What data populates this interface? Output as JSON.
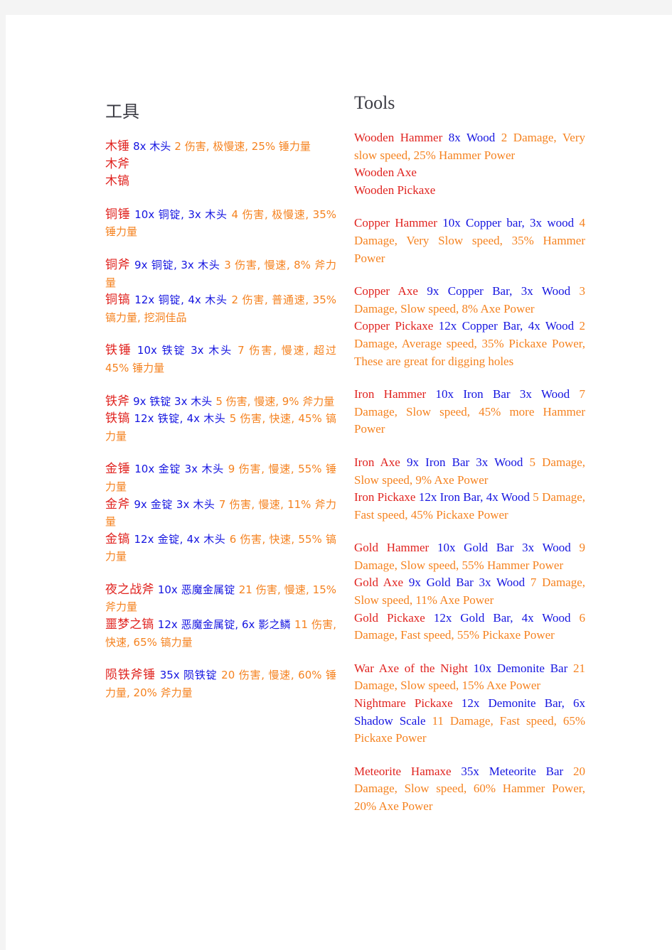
{
  "page": {
    "background": "#f4f4f4",
    "paper": "#ffffff",
    "colors": {
      "name": "#e0231f",
      "material": "#1414e0",
      "stat": "#f5821f",
      "heading": "#3a3a42"
    }
  },
  "columns": [
    {
      "id": "chinese",
      "lang": "zh",
      "heading": "工具",
      "groups": [
        {
          "entries": [
            {
              "name": "木锤",
              "material": "8x 木头",
              "stat": "2 伤害, 极慢速, 25% 锤力量"
            },
            {
              "name": "木斧",
              "material": "",
              "stat": ""
            },
            {
              "name": "木镐",
              "material": "",
              "stat": ""
            }
          ]
        },
        {
          "entries": [
            {
              "name": "铜锤",
              "material": "10x 铜锭, 3x 木头",
              "stat": "4 伤害, 极慢速, 35% 锤力量"
            }
          ]
        },
        {
          "entries": [
            {
              "name": "铜斧",
              "material": "9x 铜锭, 3x 木头",
              "stat": "3 伤害, 慢速, 8% 斧力量"
            },
            {
              "name": "铜镐",
              "material": "12x 铜锭, 4x 木头",
              "stat": "2 伤害, 普通速, 35% 镐力量, 挖洞佳品"
            }
          ]
        },
        {
          "entries": [
            {
              "name": "铁锤",
              "material": "10x 铁锭 3x 木头",
              "stat": "7 伤害, 慢速, 超过 45% 锤力量"
            }
          ]
        },
        {
          "entries": [
            {
              "name": "铁斧",
              "material": "9x 铁锭 3x 木头",
              "stat": "5 伤害, 慢速, 9% 斧力量"
            },
            {
              "name": "铁镐",
              "material": "12x 铁锭, 4x 木头",
              "stat": "5 伤害, 快速, 45% 镐力量"
            }
          ]
        },
        {
          "entries": [
            {
              "name": "金锤",
              "material": "10x 金锭 3x 木头",
              "stat": "9 伤害, 慢速, 55% 锤力量"
            },
            {
              "name": "金斧",
              "material": "9x 金锭 3x 木头",
              "stat": "7 伤害, 慢速, 11% 斧力量"
            },
            {
              "name": "金镐",
              "material": "12x 金锭, 4x 木头",
              "stat": "6 伤害, 快速, 55% 镐力量"
            }
          ]
        },
        {
          "entries": [
            {
              "name": "夜之战斧",
              "material": "10x 恶魔金属锭",
              "stat": "21 伤害, 慢速, 15% 斧力量"
            },
            {
              "name": "噩梦之镐",
              "material": "12x 恶魔金属锭, 6x 影之鳞",
              "stat": "11 伤害, 快速, 65% 镐力量"
            }
          ]
        },
        {
          "entries": [
            {
              "name": "陨铁斧锤",
              "material": "35x 陨铁锭",
              "stat": "20 伤害, 慢速, 60% 锤力量, 20% 斧力量"
            }
          ]
        }
      ]
    },
    {
      "id": "english",
      "lang": "en",
      "heading": "Tools",
      "groups": [
        {
          "entries": [
            {
              "name": "Wooden Hammer",
              "material": "8x Wood",
              "stat": "2 Damage, Very slow speed, 25% Hammer Power"
            },
            {
              "name": "Wooden Axe",
              "material": "",
              "stat": ""
            },
            {
              "name": "Wooden Pickaxe",
              "material": "",
              "stat": ""
            }
          ]
        },
        {
          "entries": [
            {
              "name": "Copper Hammer",
              "material": "10x Copper bar, 3x wood",
              "stat": "4 Damage, Very Slow speed, 35% Hammer Power"
            }
          ]
        },
        {
          "entries": [
            {
              "name": "Copper Axe",
              "material": "9x Copper Bar, 3x Wood",
              "stat": "3 Damage, Slow speed, 8% Axe Power"
            },
            {
              "name": "Copper Pickaxe",
              "material": "12x Copper Bar, 4x Wood",
              "stat": "2 Damage, Average speed, 35% Pickaxe Power, These are great for digging holes"
            }
          ]
        },
        {
          "entries": [
            {
              "name": "Iron Hammer",
              "material": "10x Iron Bar 3x Wood",
              "stat": "7 Damage, Slow speed, 45% more Hammer Power"
            }
          ]
        },
        {
          "entries": [
            {
              "name": "Iron Axe",
              "material": "9x Iron Bar 3x Wood",
              "stat": "5 Damage, Slow speed, 9% Axe Power"
            },
            {
              "name": "Iron Pickaxe",
              "material": "12x Iron Bar, 4x Wood",
              "stat": "5 Damage, Fast speed, 45% Pickaxe Power"
            }
          ]
        },
        {
          "entries": [
            {
              "name": "Gold Hammer",
              "material": "10x Gold Bar 3x Wood",
              "stat": "9 Damage, Slow speed, 55% Hammer Power"
            },
            {
              "name": "Gold Axe",
              "material": "9x Gold Bar 3x Wood",
              "stat": "7 Damage, Slow speed, 11% Axe Power"
            },
            {
              "name": "Gold Pickaxe",
              "material": "12x Gold Bar, 4x Wood",
              "stat": "6 Damage, Fast speed, 55% Pickaxe Power"
            }
          ]
        },
        {
          "entries": [
            {
              "name": "War Axe of the Night",
              "material": "10x Demonite Bar",
              "stat": "21 Damage, Slow speed, 15% Axe Power"
            },
            {
              "name": "Nightmare Pickaxe",
              "material": "12x Demonite Bar, 6x Shadow Scale",
              "stat": "11 Damage, Fast speed, 65% Pickaxe Power"
            }
          ]
        },
        {
          "entries": [
            {
              "name": "Meteorite Hamaxe",
              "material": "35x Meteorite Bar",
              "stat": "20 Damage, Slow speed, 60% Hammer Power, 20% Axe Power"
            }
          ]
        }
      ]
    }
  ]
}
